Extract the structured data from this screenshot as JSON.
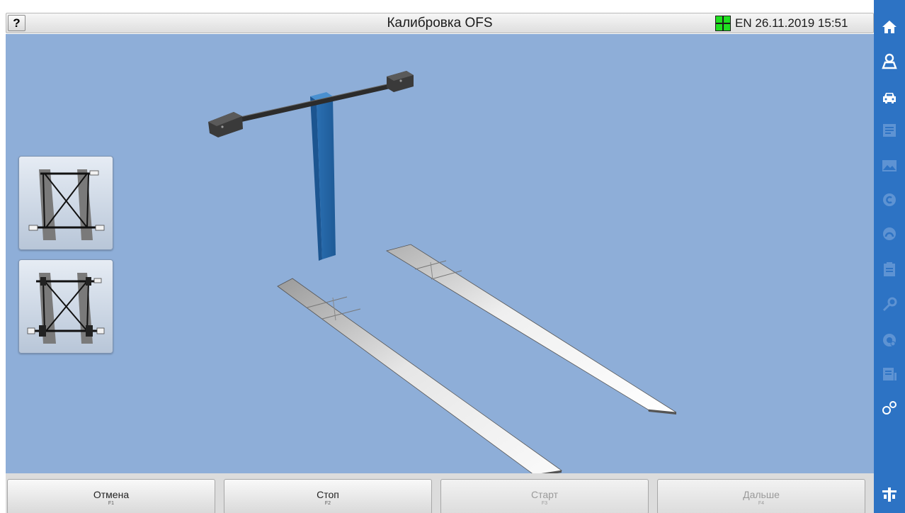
{
  "header": {
    "help_label": "?",
    "title": "Калибровка OFS",
    "status_color": "#20e020",
    "language": "EN",
    "datetime": "26.11.2019 15:51"
  },
  "thumbnails": [
    {
      "name": "lift-layout-plain",
      "selected": false
    },
    {
      "name": "lift-layout-with-clamps",
      "selected": false
    }
  ],
  "footer": {
    "buttons": [
      {
        "label": "Отмена",
        "key": "F1",
        "enabled": true
      },
      {
        "label": "Стоп",
        "key": "F2",
        "enabled": true
      },
      {
        "label": "Старт",
        "key": "F3",
        "enabled": false
      },
      {
        "label": "Дальше",
        "key": "F4",
        "enabled": false
      }
    ]
  },
  "sidebar": {
    "accent": "#2d73c4",
    "items": [
      {
        "icon": "home-icon",
        "enabled": true
      },
      {
        "icon": "customer-icon",
        "enabled": true
      },
      {
        "icon": "car-icon",
        "enabled": true
      },
      {
        "icon": "list-icon",
        "enabled": false
      },
      {
        "icon": "image-icon",
        "enabled": false
      },
      {
        "icon": "c-icon",
        "enabled": false
      },
      {
        "icon": "gauge-icon",
        "enabled": false
      },
      {
        "icon": "clipboard-icon",
        "enabled": false
      },
      {
        "icon": "wrench-icon",
        "enabled": false
      },
      {
        "icon": "settings-circle-icon",
        "enabled": false
      },
      {
        "icon": "report-icon",
        "enabled": false
      },
      {
        "icon": "gears-icon",
        "enabled": true
      },
      {
        "icon": "lift-icon",
        "enabled": true
      }
    ]
  },
  "colors": {
    "viewport_bg": "#8eaed8",
    "column": "#2a6fb2",
    "bar": "#2a2a2a"
  }
}
